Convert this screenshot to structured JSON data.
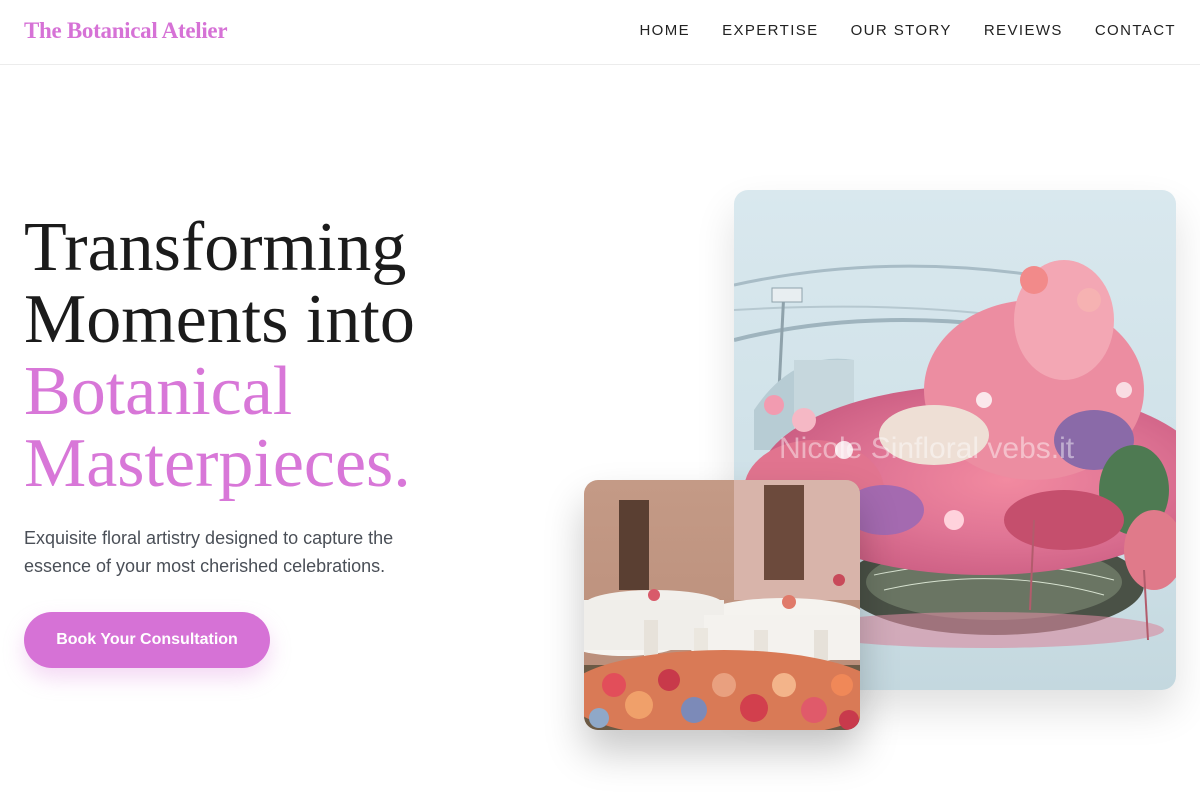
{
  "header": {
    "logo": "The Botanical Atelier",
    "nav": [
      {
        "label": "HOME"
      },
      {
        "label": "EXPERTISE"
      },
      {
        "label": "OUR STORY"
      },
      {
        "label": "REVIEWS"
      },
      {
        "label": "CONTACT"
      }
    ]
  },
  "hero": {
    "headline_line1": "Transforming",
    "headline_line2": "Moments into",
    "headline_accent_line1": "Botanical",
    "headline_accent_line2": "Masterpieces.",
    "subtext": "Exquisite floral artistry designed to capture the essence of your most cherished celebrations.",
    "cta_label": "Book Your Consultation"
  },
  "images": {
    "large_watermark": "Nicole Sinfloral vebs.it"
  },
  "colors": {
    "accent": "#d672d6",
    "text": "#1b1b1b",
    "muted": "#4a4f57"
  }
}
